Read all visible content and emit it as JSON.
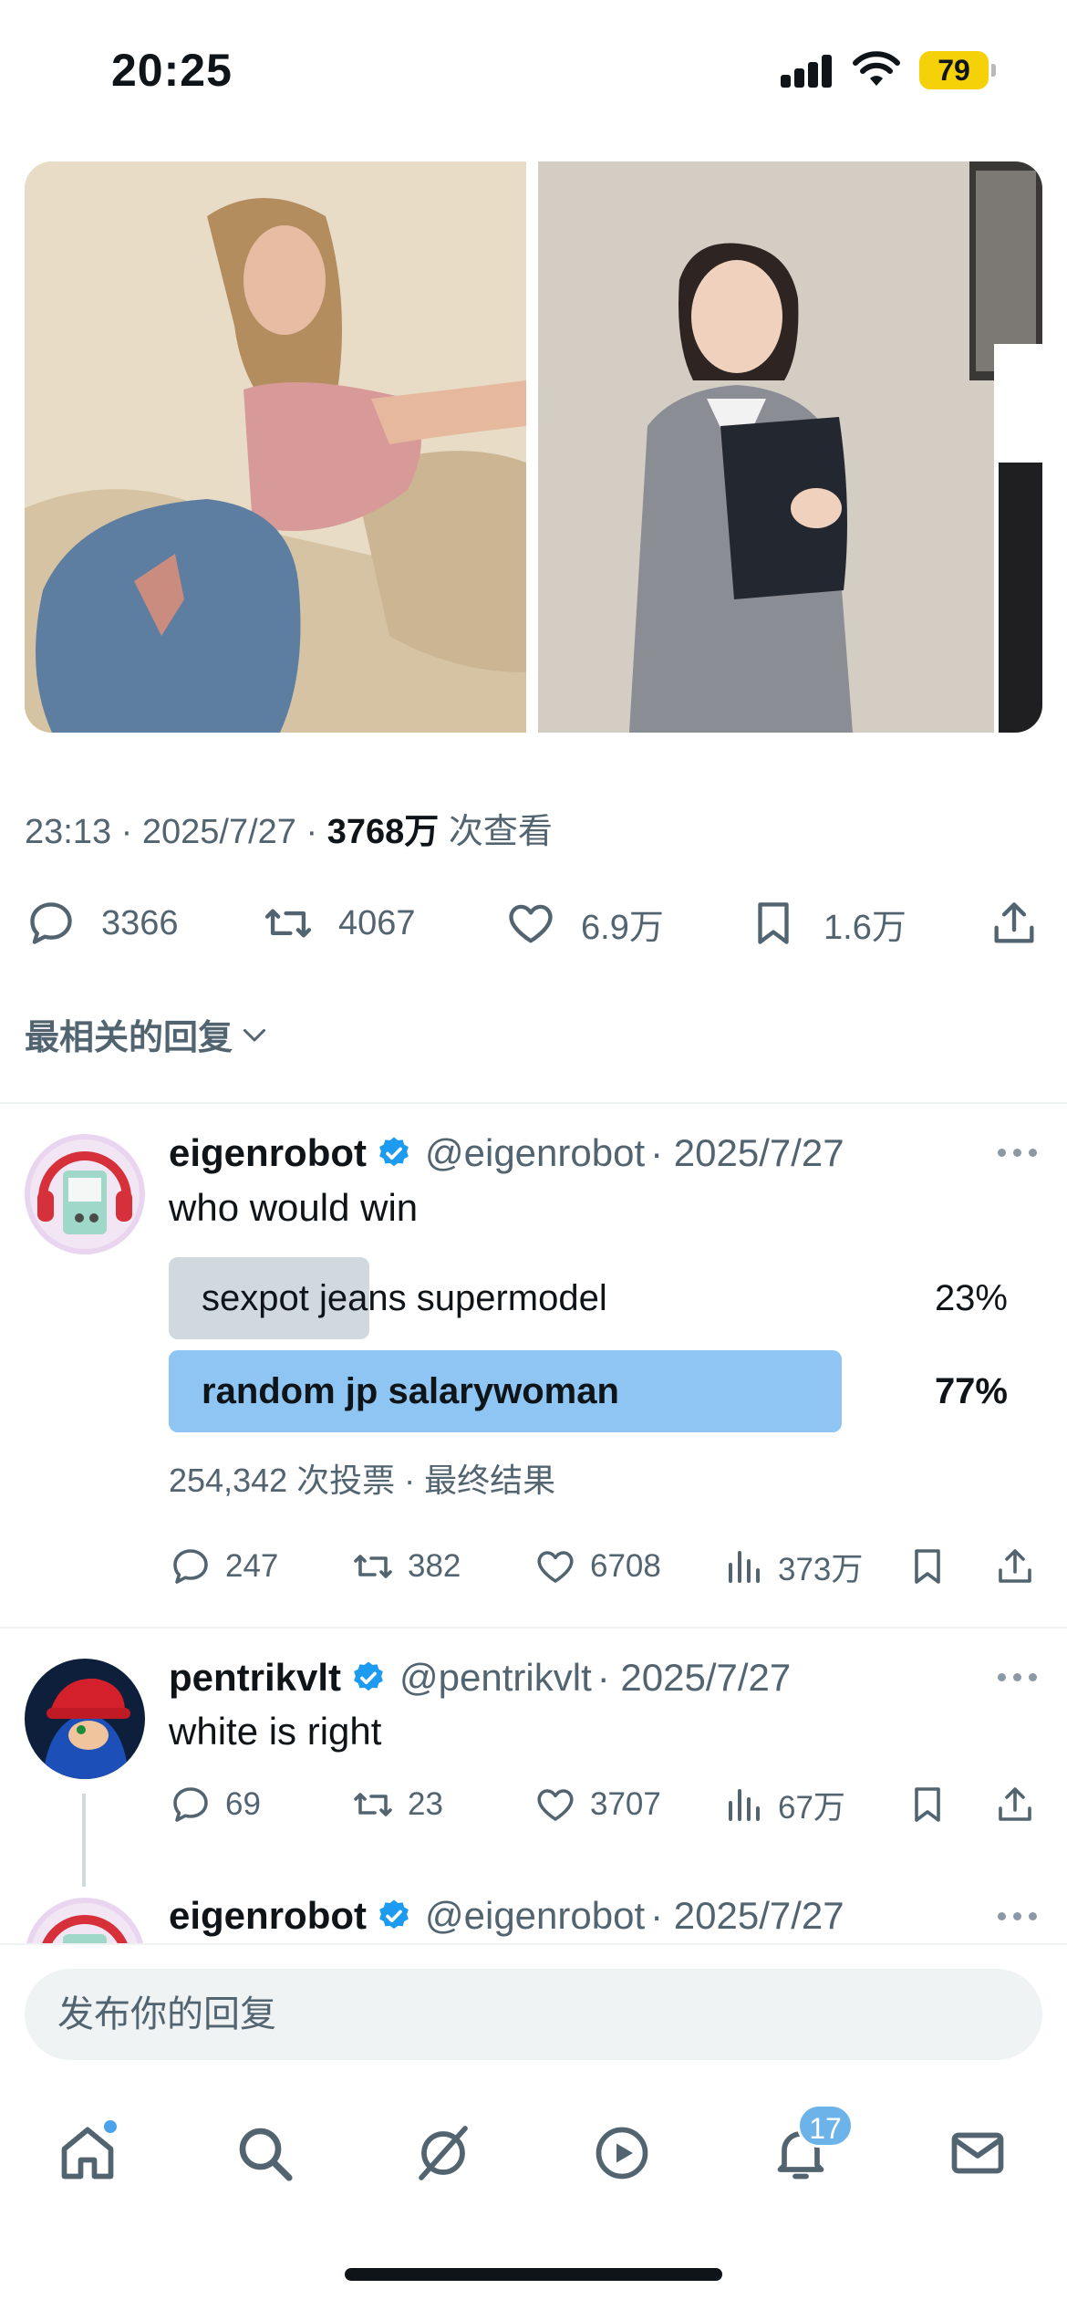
{
  "status_bar": {
    "time": "20:25",
    "battery": "79"
  },
  "post": {
    "images": [
      {
        "alt": "photo-model-jeans"
      },
      {
        "alt": "photo-woman-suit"
      }
    ],
    "time": "23:13",
    "date": "2025/7/27",
    "views": "3768万",
    "views_label": "次查看",
    "separator": "·",
    "stats": {
      "replies": "3366",
      "reposts": "4067",
      "likes": "6.9万",
      "bookmarks": "1.6万"
    }
  },
  "sort": {
    "label": "最相关的回复"
  },
  "replies": [
    {
      "name": "eigenrobot",
      "handle": "@eigenrobot",
      "date": "· 2025/7/27",
      "text": "who would win",
      "poll": {
        "options": [
          {
            "label": "sexpot jeans supermodel",
            "percent": "23%",
            "share": 0.23,
            "winner": false
          },
          {
            "label": "random jp salarywoman",
            "percent": "77%",
            "share": 0.77,
            "winner": true
          }
        ],
        "votes": "254,342 次投票 · 最终结果"
      },
      "stats": {
        "replies": "247",
        "reposts": "382",
        "likes": "6708",
        "views": "373万"
      }
    },
    {
      "name": "pentrikvlt",
      "handle": "@pentrikvlt",
      "date": "· 2025/7/27",
      "text": "white is right",
      "stats": {
        "replies": "69",
        "reposts": "23",
        "likes": "3707",
        "views": "67万"
      }
    },
    {
      "name": "eigenrobot",
      "handle": "@eigenrobot",
      "date": "· 2025/7/27"
    }
  ],
  "composer": {
    "placeholder": "发布你的回复"
  },
  "tab_bar": {
    "notifications_badge": "17"
  },
  "colors": {
    "accent": "#1d9bf0",
    "poll_winner": "#8ec5f2",
    "poll_other": "#cfd9de",
    "battery": "#f5d10a"
  }
}
